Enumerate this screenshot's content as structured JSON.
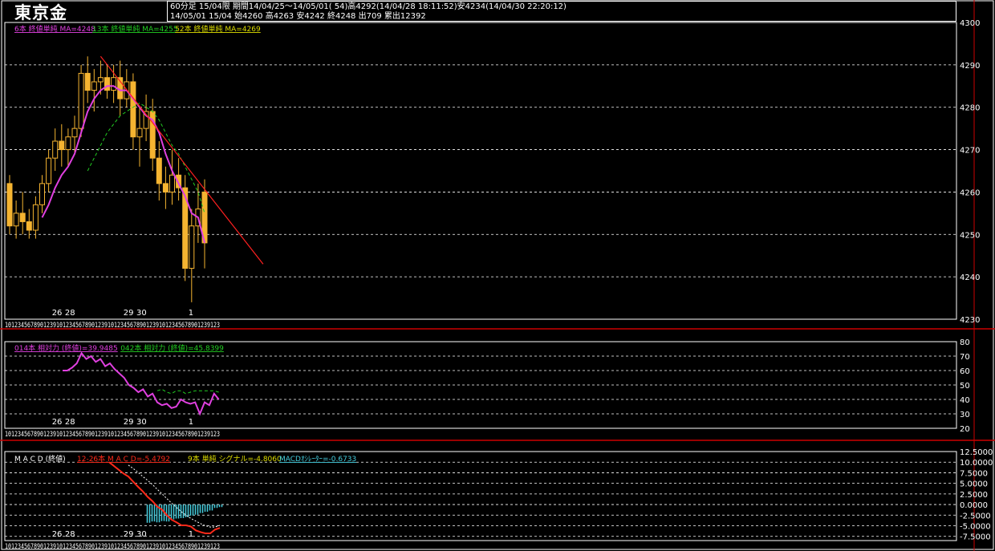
{
  "header": {
    "title": "東京金",
    "line1": "60分足 15/04限  期間14/04/25～14/05/01( 54)高4292(14/04/28 18:11:52)安4234(14/04/30 22:20:12)",
    "line2": "14/05/01 15/04 始4260 高4263 安4242 終4248 出709 累出12392"
  },
  "colors": {
    "background": "#000000",
    "frame": "#ffffff",
    "separator": "#cc0000",
    "candle": "#f5b431",
    "ma6": "#e040e0",
    "ma13": "#22cc22",
    "ma52": "#dddd00",
    "trendline": "#ff2020",
    "rsi14": "#e040e0",
    "rsi42": "#22cc22",
    "macd": "#ff2a1a",
    "signal": "#ffffff",
    "osc": "#44ccdd"
  },
  "ma_legend": [
    {
      "text": "6本 終値単純 MA=4248",
      "color": "#e040e0"
    },
    {
      "text": "13本 終値単純 MA=4255",
      "color": "#22cc22"
    },
    {
      "text": "52本 終値単純 MA=4269",
      "color": "#dddd00"
    }
  ],
  "rsi_legend": [
    {
      "text": "014本 相対力 (終値)=39.9485",
      "color": "#e040e0"
    },
    {
      "text": "042本 相対力 (終値)=45.8399",
      "color": "#22cc22"
    }
  ],
  "macd_legend": [
    {
      "text": "M A C D (終値)",
      "color": "#ffffff"
    },
    {
      "text": "12-26本 M A C D=-5.4792",
      "color": "#ff2a1a"
    },
    {
      "text": "9本 単純 シグナル=-4.8060",
      "color": "#dddd00"
    },
    {
      "text": "MACDｵｼﾚｰﾀｰ=-0.6733",
      "color": "#44ccdd"
    }
  ],
  "x_axis": {
    "date_labels": [
      {
        "text": "26",
        "index": 7
      },
      {
        "text": "28",
        "index": 9
      },
      {
        "text": "29",
        "index": 18
      },
      {
        "text": "30",
        "index": 20
      },
      {
        "text": "1",
        "index": 28
      }
    ],
    "hour_digits": "1012345678901239101234567890123910123456789012391012345678901239123"
  },
  "chart_data": [
    {
      "type": "candlestick",
      "title": "東京金",
      "ylim": [
        4230,
        4300
      ],
      "yticks": [
        "4230",
        "4240",
        "4250",
        "4260",
        "4270",
        "4280",
        "4290",
        "4300"
      ],
      "grid": true,
      "ohlc": [
        [
          4262,
          4264,
          4250,
          4252
        ],
        [
          4252,
          4258,
          4249,
          4255
        ],
        [
          4255,
          4260,
          4250,
          4253
        ],
        [
          4253,
          4256,
          4249,
          4251
        ],
        [
          4251,
          4259,
          4249,
          4257
        ],
        [
          4257,
          4264,
          4255,
          4262
        ],
        [
          4262,
          4270,
          4260,
          4268
        ],
        [
          4268,
          4275,
          4265,
          4272
        ],
        [
          4272,
          4276,
          4266,
          4270
        ],
        [
          4270,
          4275,
          4266,
          4273
        ],
        [
          4273,
          4278,
          4269,
          4275
        ],
        [
          4275,
          4290,
          4273,
          4288
        ],
        [
          4288,
          4292,
          4281,
          4284
        ],
        [
          4284,
          4289,
          4279,
          4286
        ],
        [
          4286,
          4291,
          4283,
          4287
        ],
        [
          4287,
          4290,
          4282,
          4284
        ],
        [
          4284,
          4290,
          4281,
          4287
        ],
        [
          4287,
          4291,
          4278,
          4282
        ],
        [
          4282,
          4289,
          4280,
          4286
        ],
        [
          4286,
          4288,
          4270,
          4273
        ],
        [
          4273,
          4280,
          4266,
          4275
        ],
        [
          4275,
          4283,
          4272,
          4279
        ],
        [
          4279,
          4282,
          4265,
          4268
        ],
        [
          4268,
          4272,
          4258,
          4262
        ],
        [
          4262,
          4266,
          4256,
          4260
        ],
        [
          4260,
          4270,
          4257,
          4264
        ],
        [
          4264,
          4268,
          4258,
          4261
        ],
        [
          4261,
          4264,
          4239,
          4242
        ],
        [
          4242,
          4256,
          4234,
          4252
        ],
        [
          4252,
          4262,
          4248,
          4256
        ],
        [
          4260,
          4263,
          4242,
          4248
        ]
      ],
      "ma6": [
        null,
        null,
        null,
        null,
        null,
        4254,
        4257,
        4261,
        4264,
        4266,
        4269,
        4274,
        4279,
        4282,
        4284,
        4285,
        4285,
        4284,
        4284,
        4282,
        4280,
        4278,
        4277,
        4274,
        4269,
        4265,
        4262,
        4259,
        4255,
        4254,
        4248
      ],
      "ma13": [
        null,
        null,
        null,
        null,
        null,
        null,
        null,
        null,
        null,
        null,
        null,
        null,
        4265,
        4268,
        4271,
        4274,
        4276,
        4278,
        4279,
        4280,
        4281,
        4280,
        4279,
        4277,
        4274,
        4271,
        4269,
        4266,
        4263,
        4260,
        4255
      ],
      "trendline": {
        "from": {
          "index": 14,
          "value": 4292
        },
        "to": {
          "index": 39,
          "value": 4243
        }
      }
    },
    {
      "type": "line",
      "title": "相対力 (終値)",
      "ylim": [
        20,
        80
      ],
      "yticks": [
        "20",
        "30",
        "40",
        "50",
        "60",
        "70",
        "80"
      ],
      "grid": true,
      "series": [
        {
          "name": "014本 相対力 (終値)",
          "values": [
            60,
            60,
            62,
            65,
            72,
            68,
            70,
            66,
            68,
            63,
            65,
            61,
            58,
            55,
            50,
            48,
            45,
            47,
            42,
            44,
            38,
            36,
            37,
            34,
            35,
            40,
            38,
            37,
            38,
            30,
            38,
            36,
            44,
            40
          ]
        },
        {
          "name": "042本 相対力 (終値)",
          "values": [
            null,
            null,
            null,
            null,
            null,
            null,
            null,
            null,
            null,
            null,
            null,
            null,
            null,
            null,
            null,
            null,
            null,
            null,
            null,
            null,
            46,
            47,
            45,
            44,
            46,
            46,
            44,
            45,
            46,
            46,
            46,
            46,
            46,
            45
          ]
        }
      ]
    },
    {
      "type": "line",
      "title": "M A C D (終値)",
      "ylim": [
        -8.5,
        12.5
      ],
      "yticks": [
        "12.5000",
        "10.0000",
        "7.5000",
        "5.0000",
        "2.5000",
        "0.0000",
        "-2.5000",
        "-5.0000",
        "-7.5000"
      ],
      "grid": true,
      "series": [
        {
          "name": "12-26本 M A C D",
          "values": [
            10.0,
            9.1,
            8.2,
            7.3,
            6.6,
            5.4,
            4.2,
            3.1,
            1.8,
            0.8,
            -0.5,
            -1.2,
            -2.5,
            -3.6,
            -4.2,
            -4.9,
            -4.9,
            -5.2,
            -6.1,
            -6.5,
            -6.8,
            -6.8,
            -5.9,
            -5.5
          ]
        },
        {
          "name": "9本 単純 シグナル",
          "values": [
            null,
            null,
            null,
            null,
            9.3,
            8.5,
            7.6,
            6.6,
            5.7,
            4.7,
            3.6,
            2.5,
            1.4,
            0.3,
            -0.7,
            -1.7,
            -2.5,
            -3.3,
            -3.9,
            -4.5,
            -5.0,
            -5.3,
            -5.3,
            -4.9
          ]
        },
        {
          "name": "MACDｵｼﾚｰﾀｰ",
          "values": [
            null,
            null,
            null,
            null,
            null,
            null,
            null,
            null,
            -4.3,
            -4.0,
            -4.2,
            -3.9,
            -4.0,
            -3.5,
            -3.3,
            -3.2,
            -3.0,
            -2.6,
            -2.4,
            -2.0,
            -1.7,
            -1.4,
            -0.8,
            -0.6
          ]
        }
      ]
    }
  ]
}
